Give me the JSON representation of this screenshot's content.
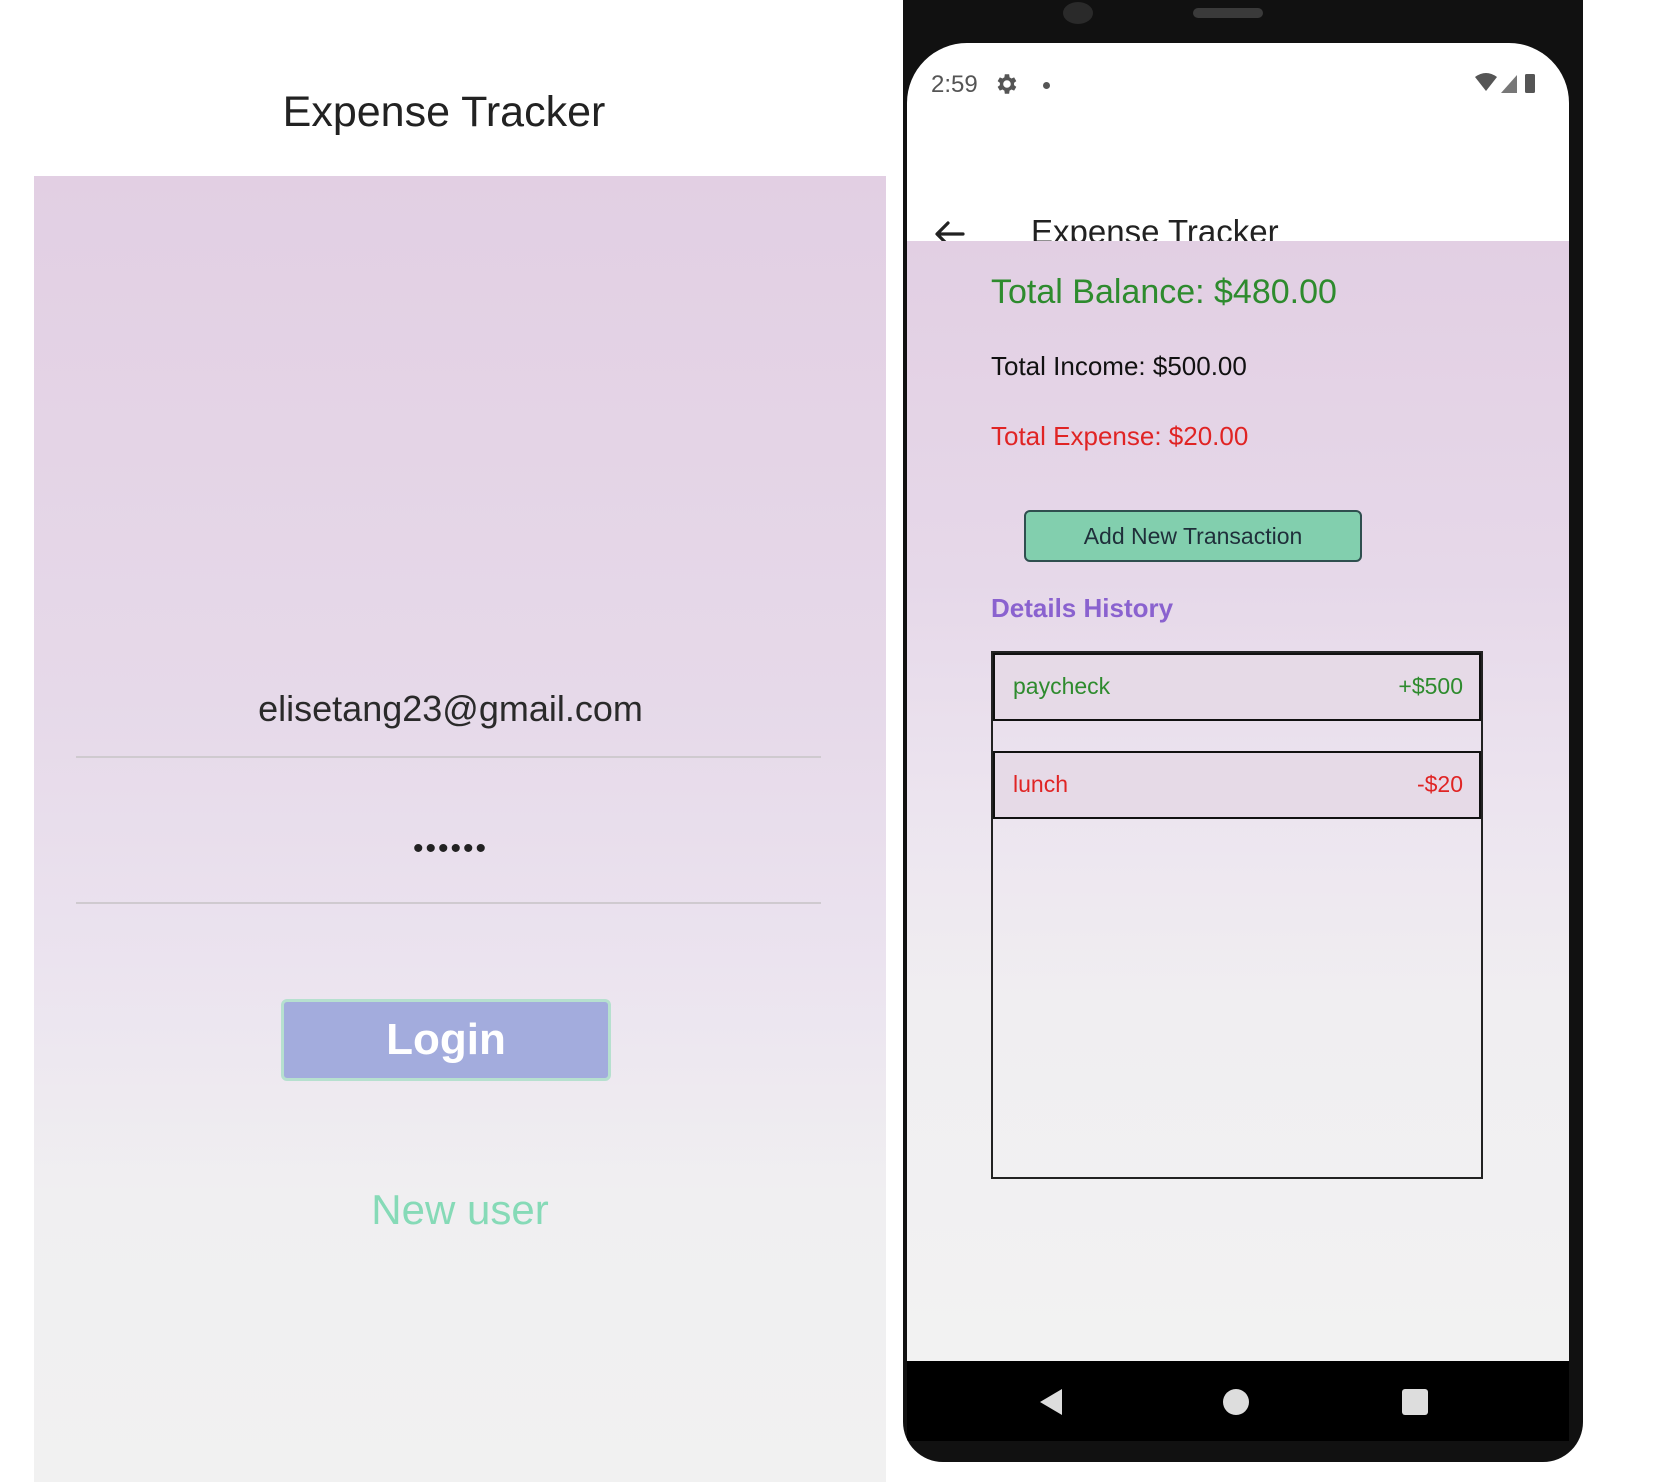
{
  "login": {
    "title": "Expense Tracker",
    "email_value": "elisetang23@gmail.com",
    "password_value": "••••••",
    "login_label": "Login",
    "new_user_label": "New user"
  },
  "phone": {
    "status_bar": {
      "time": "2:59",
      "icons": [
        "gear-icon",
        "dot",
        "wifi-icon",
        "signal-icon",
        "battery-icon"
      ]
    },
    "app_bar": {
      "title": "Expense Tracker",
      "back_icon": "arrow-left-icon"
    },
    "summary": {
      "total_balance": "Total Balance: $480.00",
      "total_income": "Total Income: $500.00",
      "total_expense": "Total Expense: $20.00"
    },
    "add_transaction_label": "Add New Transaction",
    "history_heading": "Details History",
    "transactions": [
      {
        "name": "paycheck",
        "amount": "+$500"
      },
      {
        "name": "lunch",
        "amount": "-$20"
      }
    ],
    "nav_bar": {
      "icons": [
        "back-triangle-icon",
        "home-circle-icon",
        "recents-square-icon"
      ]
    }
  },
  "colors": {
    "balance_green": "#2e8b2e",
    "expense_red": "#e02424",
    "login_button_bg": "#a3acdd",
    "new_user_link": "#86dab7",
    "add_button_bg": "#82cfae",
    "history_heading": "#8a62cf",
    "panel_top": "#e2cfe3"
  }
}
